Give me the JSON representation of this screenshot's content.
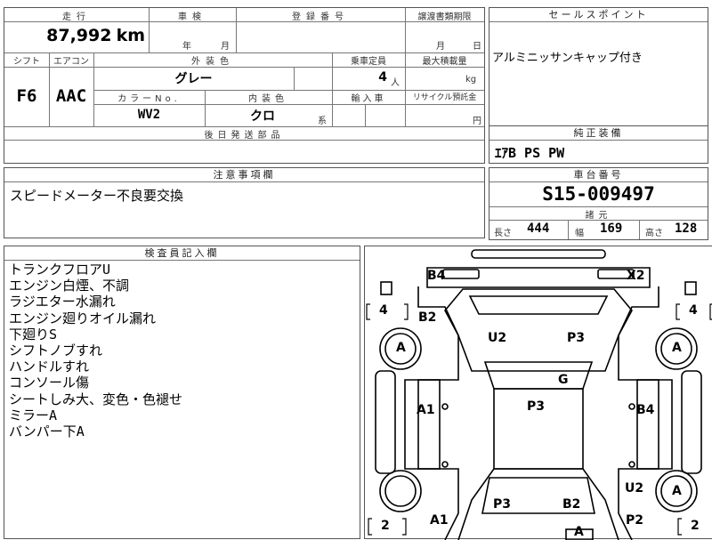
{
  "main": {
    "mileage_label": "走行",
    "mileage_value": "87,992",
    "mileage_unit": "km",
    "inspection_label": "車検",
    "inspection_year_unit": "年",
    "inspection_month_unit": "月",
    "registration_label": "登録番号",
    "transfer_label": "譲渡書類期限",
    "transfer_month_unit": "月",
    "transfer_day_unit": "日",
    "shift_label": "シフト",
    "shift_value": "F6",
    "ac_label": "エアコン",
    "ac_value": "AAC",
    "exterior_label": "外装色",
    "exterior_value": "グレー",
    "capacity_label": "乗車定員",
    "capacity_value": "4",
    "capacity_unit": "人",
    "load_label": "最大積載量",
    "load_unit": "kg",
    "color_no_label": "カラーNo.",
    "color_no_value": "WV2",
    "interior_label": "内装色",
    "interior_value": "クロ",
    "interior_suffix": "系",
    "import_label": "輸入車",
    "recycle_label": "リサイクル預託金",
    "recycle_unit": "円",
    "later_parts_label": "後日発送部品"
  },
  "sales_point": {
    "label": "セールスポイント",
    "text": "アルミニッサンキャップ付き"
  },
  "equipment": {
    "label": "純正装備",
    "text": "ｴｱB PS PW"
  },
  "notes": {
    "label": "注意事項欄",
    "text": "スピードメーター不良要交換"
  },
  "chassis": {
    "label": "車台番号",
    "value": "S15-009497",
    "spec_label": "諸元",
    "length_label": "長さ",
    "length_value": "444",
    "width_label": "幅",
    "width_value": "169",
    "height_label": "高さ",
    "height_value": "128"
  },
  "inspector": {
    "label": "検査員記入欄",
    "lines": [
      "トランクフロアU",
      "エンジン白煙、不調",
      "ラジエター水漏れ",
      "エンジン廻りオイル漏れ",
      "下廻りS",
      "シフトノブすれ",
      "ハンドルすれ",
      "コンソール傷",
      "シートしみ大、変色・色褪せ",
      "ミラーA",
      "バンパー下A"
    ]
  },
  "diagram": {
    "b4_top": "B4",
    "x2": "X2",
    "tire_rl_top": "4",
    "tire_rr_top": "4",
    "tire_l_bottom": "2",
    "tire_r_bottom": "2",
    "b2_left": "B2",
    "wheel_a_lt": "A",
    "wheel_a_rt": "A",
    "wheel_a_rb": "A",
    "u2_top": "U2",
    "p3_top": "P3",
    "g": "G",
    "p3_center": "P3",
    "a1_left": "A1",
    "b4_right": "B4",
    "u2_right": "U2",
    "p3_bottom": "P3",
    "b2_bottom": "B2",
    "a1_bottom": "A1",
    "p2": "P2",
    "a_front": "A"
  }
}
